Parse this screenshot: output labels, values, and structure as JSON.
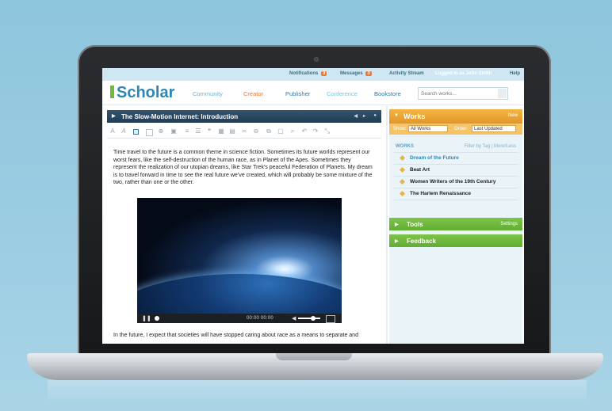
{
  "topbar": {
    "notifications_label": "Notifications",
    "notifications_count": "3",
    "messages_label": "Messages",
    "messages_count": "3",
    "activity_label": "Activity Stream",
    "logged_in": "Logged in as John Smith",
    "help": "Help"
  },
  "header": {
    "logo": "Scholar",
    "nav": {
      "community": "Community",
      "creator": "Creator",
      "publisher": "Publisher",
      "conference": "Conference",
      "bookstore": "Bookstore"
    },
    "search_placeholder": "Search works..."
  },
  "document": {
    "title": "The Slow-Motion Internet: Introduction",
    "paragraph1": "Time travel to the future is a common theme in science fiction. Sometimes its future worlds represent our worst fears, like the self-destruction of the human race, as in Planet of the Apes. Sometimes they represent the realization of our utopian dreams, like Star Trek’s peaceful Federation of Planets. My dream is to travel forward in time to see the real future we’ve created, which will probably be some mixture of the two, rather than one or the other.",
    "video_time": "00:00   00:00",
    "paragraph2": "In the future, I expect that societies will have stopped caring about race as a means to separate and"
  },
  "sidebar": {
    "works_title": "Works",
    "new_label": "New",
    "show_label": "Show:",
    "show_value": "All Works",
    "order_label": "Order:",
    "order_value": "Last Updated",
    "works_header": "WORKS",
    "works_header_right": "Filter by Tag  |  More/Less",
    "works": [
      "Dream of the Future",
      "Beat Art",
      "Women Writers of the 19th Century",
      "The Harlem Renaissance"
    ],
    "tools_title": "Tools",
    "tools_settings": "Settings",
    "feedback_title": "Feedback"
  },
  "colors": {
    "brand_blue": "#2f86b3",
    "creator_orange": "#e8793a",
    "works_orange": "#f2b542",
    "green": "#7cc447"
  }
}
